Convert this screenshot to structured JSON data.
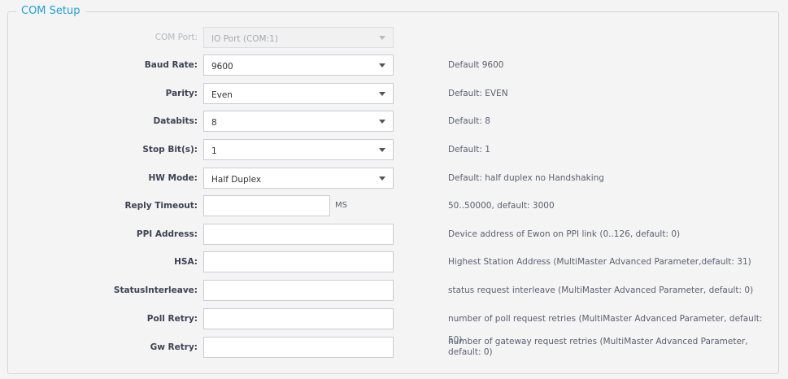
{
  "panel": {
    "title": "COM Setup"
  },
  "fields": {
    "com_port": {
      "label": "COM Port:",
      "value": "IO Port (COM:1)"
    },
    "baud_rate": {
      "label": "Baud Rate:",
      "value": "9600",
      "hint": "Default 9600"
    },
    "parity": {
      "label": "Parity:",
      "value": "Even",
      "hint": "Default: EVEN"
    },
    "databits": {
      "label": "Databits:",
      "value": "8",
      "hint": "Default: 8"
    },
    "stop_bits": {
      "label": "Stop Bit(s):",
      "value": "1",
      "hint": "Default: 1"
    },
    "hw_mode": {
      "label": "HW Mode:",
      "value": "Half Duplex",
      "hint": "Default: half duplex no Handshaking"
    },
    "reply_timeout": {
      "label": "Reply Timeout:",
      "value": "",
      "unit": "MS",
      "hint": "50..50000, default: 3000"
    },
    "ppi_address": {
      "label": "PPI Address:",
      "value": "",
      "hint": "Device address of Ewon on PPI link (0..126, default: 0)"
    },
    "hsa": {
      "label": "HSA:",
      "value": "",
      "hint": "Highest Station Address (MultiMaster Advanced Parameter,default: 31)"
    },
    "status_interleave": {
      "label": "StatusInterleave:",
      "value": "",
      "hint": "status request interleave (MultiMaster Advanced Parameter, default: 0)"
    },
    "poll_retry": {
      "label": "Poll Retry:",
      "value": "",
      "hint": "number of poll request retries (MultiMaster Advanced Parameter, default: 50)"
    },
    "gw_retry": {
      "label": "Gw Retry:",
      "value": "",
      "hint": "number of gateway request retries (MultiMaster Advanced Parameter, default: 0)"
    }
  },
  "colors": {
    "accent": "#1e9fd3",
    "label": "#3c4352",
    "hint": "#5b6170",
    "border": "#c9ccd1"
  },
  "icons": {
    "dropdown": "chevron-down-icon"
  }
}
